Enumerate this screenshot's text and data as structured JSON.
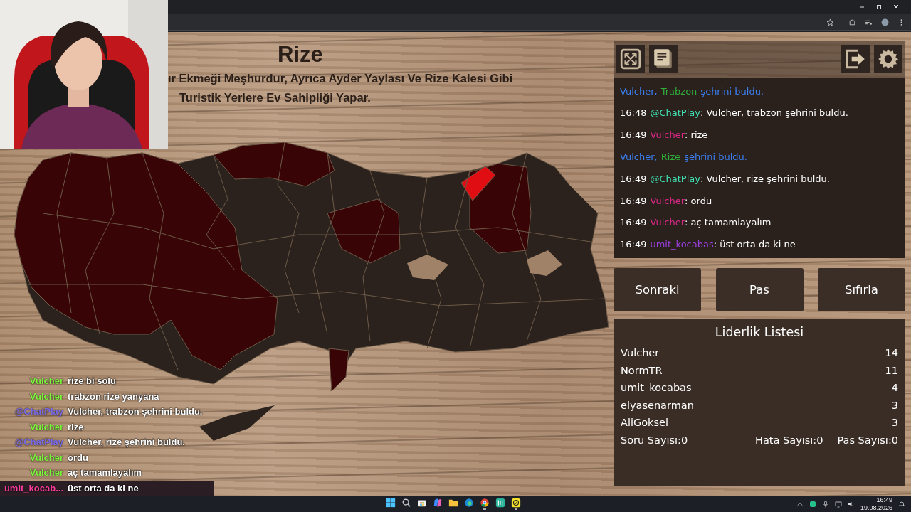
{
  "game": {
    "title": "Rize",
    "description": [
      "ır Ekmeği Meşhurdur, Ayrıca Ayder Yaylası Ve Rize Kalesi Gibi",
      "Turistik Yerlere Ev Sahipliği Yapar."
    ]
  },
  "stream_chat": [
    {
      "user": "Vulcher",
      "color": "#7cf53c",
      "text": "rize bi solu",
      "highlighted": false
    },
    {
      "user": "Vulcher",
      "color": "#7cf53c",
      "text": "trabzon rize yanyana",
      "highlighted": false
    },
    {
      "user": "@ChatPlay",
      "color": "#7a6ae8",
      "text": "Vulcher, trabzon şehrini buldu.",
      "highlighted": false
    },
    {
      "user": "Vulcher",
      "color": "#7cf53c",
      "text": "rize",
      "highlighted": false
    },
    {
      "user": "@ChatPlay",
      "color": "#7a6ae8",
      "text": "Vulcher, rize şehrini buldu.",
      "highlighted": false
    },
    {
      "user": "Vulcher",
      "color": "#7cf53c",
      "text": "ordu",
      "highlighted": false
    },
    {
      "user": "Vulcher",
      "color": "#7cf53c",
      "text": "aç tamamlayalım",
      "highlighted": false
    },
    {
      "user": "umit_kocab...",
      "color": "#ff3d9e",
      "text": "üst orta da ki ne",
      "highlighted": true
    }
  ],
  "chat_log": [
    {
      "kind": "announce",
      "user": "Vulcher,",
      "city": "Trabzon",
      "text": "şehrini buldu."
    },
    {
      "kind": "message",
      "time": "16:48",
      "user": "@ChatPlay",
      "color": "#3fe3b4",
      "text": ": Vulcher, trabzon şehrini buldu."
    },
    {
      "kind": "message",
      "time": "16:49",
      "user": "Vulcher",
      "color": "#e0288a",
      "text": ": rize"
    },
    {
      "kind": "announce",
      "user": "Vulcher,",
      "city": "Rize",
      "text": "şehrini buldu."
    },
    {
      "kind": "message",
      "time": "16:49",
      "user": "@ChatPlay",
      "color": "#3fe3b4",
      "text": ": Vulcher, rize şehrini buldu."
    },
    {
      "kind": "message",
      "time": "16:49",
      "user": "Vulcher",
      "color": "#e0288a",
      "text": ": ordu"
    },
    {
      "kind": "message",
      "time": "16:49",
      "user": "Vulcher",
      "color": "#e0288a",
      "text": ": aç tamamlayalım"
    },
    {
      "kind": "message",
      "time": "16:49",
      "user": "umit_kocabas",
      "color": "#9b3fe0",
      "text": ": üst orta da ki ne"
    }
  ],
  "buttons": [
    "Sonraki",
    "Pas",
    "Sıfırla"
  ],
  "leaderboard": {
    "title": "Liderlik Listesi",
    "rows": [
      {
        "name": "Vulcher",
        "score": "14"
      },
      {
        "name": "NormTR",
        "score": "11"
      },
      {
        "name": "umit_kocabas",
        "score": "4"
      },
      {
        "name": "elyasenarman",
        "score": "3"
      },
      {
        "name": "AliGoksel",
        "score": "3"
      }
    ],
    "stats": [
      "Soru Sayısı:0",
      "Hata Sayısı:0",
      "Pas Sayısı:0"
    ]
  },
  "taskbar": {
    "apps": [
      {
        "kind": "start",
        "running": false
      },
      {
        "kind": "search",
        "running": false
      },
      {
        "kind": "store",
        "running": false
      },
      {
        "kind": "copilot",
        "running": false
      },
      {
        "kind": "folder",
        "running": false
      },
      {
        "kind": "edge",
        "running": false
      },
      {
        "kind": "chrome",
        "running": true
      },
      {
        "kind": "green-app",
        "running": false
      },
      {
        "kind": "yellow-app",
        "running": true
      }
    ],
    "time": "16:49",
    "date": "19.08.2026"
  }
}
